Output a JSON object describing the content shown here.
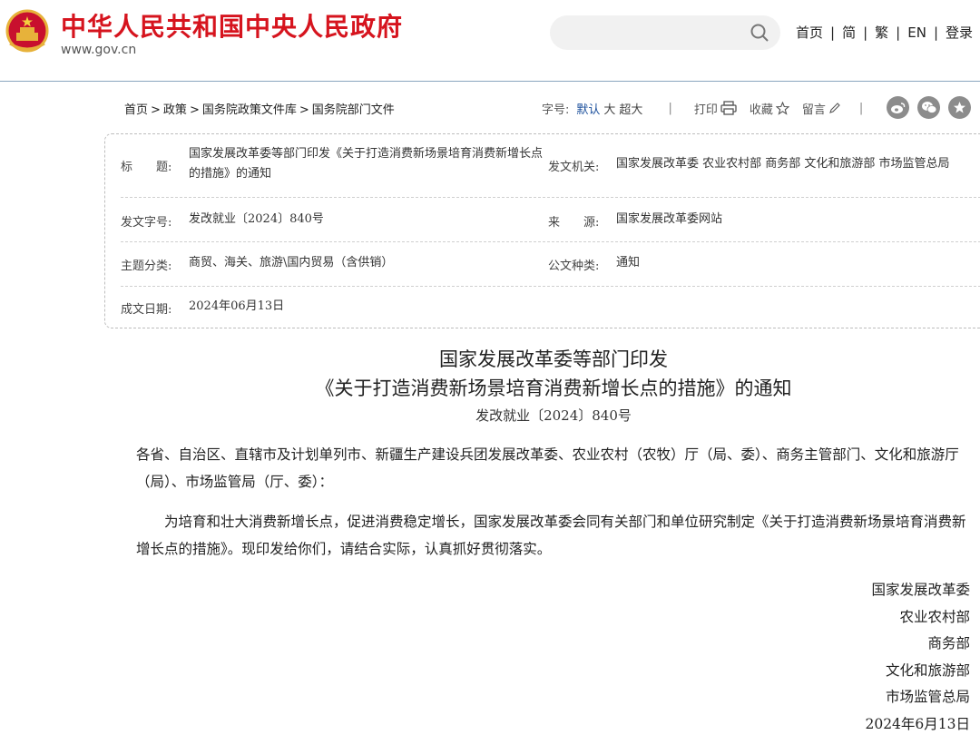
{
  "header": {
    "site_title": "中华人民共和国中央人民政府",
    "site_url": "www.gov.cn",
    "search_placeholder": "",
    "nav": [
      "首页",
      "简",
      "繁",
      "EN",
      "登录"
    ]
  },
  "breadcrumb": [
    "首页",
    "政策",
    "国务院政策文件库",
    "国务院部门文件"
  ],
  "toolbar": {
    "font_label": "字号:",
    "font_sizes": [
      "默认",
      "大",
      "超大"
    ],
    "print_label": "打印",
    "favorite_label": "收藏",
    "comment_label": "留言",
    "share_icons": [
      "weibo-icon",
      "wechat-icon",
      "star-icon"
    ]
  },
  "info": {
    "title_label": "标　　题:",
    "title_value": "国家发展改革委等部门印发《关于打造消费新场景培育消费新增长点的措施》的通知",
    "issuer_label": "发文机关:",
    "issuer_value": "国家发展改革委 农业农村部 商务部 文化和旅游部 市场监管总局",
    "doc_no_label": "发文字号:",
    "doc_no_value": "发改就业〔2024〕840号",
    "source_label": "来　　源:",
    "source_value": "国家发展改革委网站",
    "topic_label": "主题分类:",
    "topic_value": "商贸、海关、旅游\\国内贸易（含供销）",
    "type_label": "公文种类:",
    "type_value": "通知",
    "date_label": "成文日期:",
    "date_value": "2024年06月13日"
  },
  "document": {
    "title_line1": "国家发展改革委等部门印发",
    "title_line2": "《关于打造消费新场景培育消费新增长点的措施》的通知",
    "doc_number": "发改就业〔2024〕840号",
    "salutation": "各省、自治区、直辖市及计划单列市、新疆生产建设兵团发展改革委、农业农村（农牧）厅（局、委）、商务主管部门、文化和旅游厅（局）、市场监管局（厅、委）：",
    "body": "为培育和壮大消费新增长点，促进消费稳定增长，国家发展改革委会同有关部门和单位研究制定《关于打造消费新场景培育消费新增长点的措施》。现印发给你们，请结合实际，认真抓好贯彻落实。",
    "signatories": [
      "国家发展改革委",
      "农业农村部",
      "商务部",
      "文化和旅游部",
      "市场监管总局",
      "2024年6月13日"
    ]
  },
  "colors": {
    "brand_red": "#d6141e",
    "active_blue": "#1a4e9b",
    "header_rule": "#8aa6bf"
  }
}
